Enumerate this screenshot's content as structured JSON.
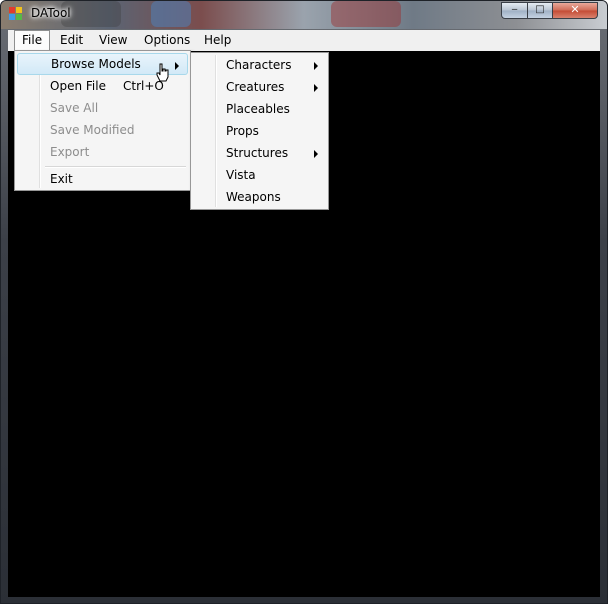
{
  "window": {
    "title": "DATool",
    "controls": {
      "minimize_glyph": "‒",
      "maximize_glyph": "□",
      "close_glyph": "✕"
    }
  },
  "icons": {
    "app": "app-icon",
    "cursor": "hand-pointer-icon",
    "submenu": "submenu-arrow-icon"
  },
  "menubar": {
    "items": [
      {
        "label": "File",
        "open": true
      },
      {
        "label": "Edit"
      },
      {
        "label": "View"
      },
      {
        "label": "Options"
      },
      {
        "label": "Help"
      }
    ]
  },
  "file_menu": {
    "items": [
      {
        "label": "Browse Models",
        "highlighted": true,
        "submenu": true
      },
      {
        "label": "Open File",
        "shortcut": "Ctrl+O"
      },
      {
        "label": "Save All",
        "disabled": true
      },
      {
        "label": "Save Modified",
        "disabled": true
      },
      {
        "label": "Export",
        "disabled": true
      },
      {
        "label": "Exit"
      }
    ]
  },
  "browse_models_menu": {
    "items": [
      {
        "label": "Characters",
        "submenu": true
      },
      {
        "label": "Creatures",
        "submenu": true
      },
      {
        "label": "Placeables",
        "submenu": false
      },
      {
        "label": "Props",
        "submenu": false
      },
      {
        "label": "Structures",
        "submenu": true
      },
      {
        "label": "Vista",
        "submenu": false
      },
      {
        "label": "Weapons",
        "submenu": false
      }
    ]
  },
  "colors": {
    "client_background": "#000000",
    "menu_background": "#f5f5f5",
    "highlight_border": "#a8d8eb",
    "disabled_text": "#8d8d8d"
  }
}
